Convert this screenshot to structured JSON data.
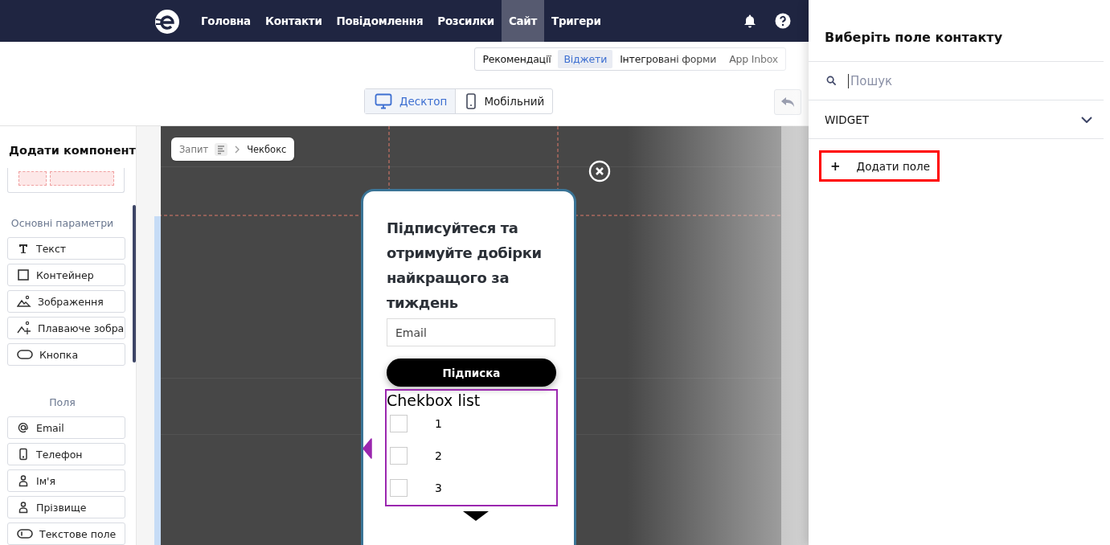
{
  "nav": {
    "items": [
      {
        "label": "Головна",
        "selected": false
      },
      {
        "label": "Контакти",
        "selected": false
      },
      {
        "label": "Повідомлення",
        "selected": false
      },
      {
        "label": "Розсилки",
        "selected": false
      },
      {
        "label": "Сайт",
        "selected": true
      },
      {
        "label": "Тригери",
        "selected": false
      }
    ]
  },
  "subtabs": [
    {
      "label": "Рекомендації",
      "selected": false
    },
    {
      "label": "Віджети",
      "selected": true
    },
    {
      "label": "Інтегровані форми",
      "selected": false
    },
    {
      "label": "App Inbox",
      "selected": false
    }
  ],
  "view_toggle": [
    {
      "label": "Десктоп",
      "selected": true,
      "kind": "desktop"
    },
    {
      "label": "Мобільний",
      "selected": false,
      "kind": "mobile"
    }
  ],
  "sidebar": {
    "title": "Додати компонент",
    "sections": [
      {
        "heading": "Основні параметри",
        "items": [
          {
            "label": "Текст",
            "kind": "text"
          },
          {
            "label": "Контейнер",
            "kind": "container"
          },
          {
            "label": "Зображення",
            "kind": "image"
          },
          {
            "label": "Плаваюче зобра",
            "kind": "floating-image"
          },
          {
            "label": "Кнопка",
            "kind": "button"
          }
        ]
      },
      {
        "heading": "Поля",
        "items": [
          {
            "label": "Email",
            "kind": "email"
          },
          {
            "label": "Телефон",
            "kind": "phone"
          },
          {
            "label": "Ім'я",
            "kind": "person"
          },
          {
            "label": "Прізвище",
            "kind": "person"
          },
          {
            "label": "Текстове поле",
            "kind": "textfield"
          }
        ]
      }
    ]
  },
  "breadcrumb": [
    "Запит",
    "Чекбокс"
  ],
  "widget": {
    "heading": "Підписуйтеся та отримуйте добірки найкращого за тиждень",
    "email": {
      "placeholder": "Email"
    },
    "button": "Підписка",
    "checkbox_list": {
      "title": "Chekbox list",
      "items": [
        {
          "label": "1",
          "checked": false
        },
        {
          "label": "2",
          "checked": false
        },
        {
          "label": "3",
          "checked": false
        }
      ]
    }
  },
  "drawer": {
    "title": "Виберіть поле контакту",
    "search": {
      "placeholder": "Пошук"
    },
    "group": {
      "label": "WIDGET",
      "expanded": false
    },
    "add_button": {
      "icon": "+",
      "label": "Додати поле"
    }
  }
}
